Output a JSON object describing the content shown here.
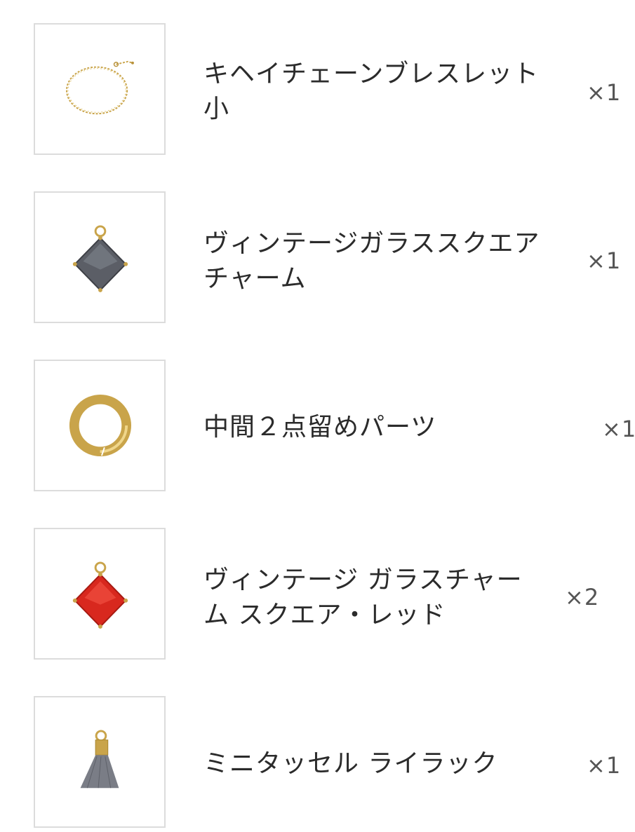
{
  "items": [
    {
      "name": "キヘイチェーンブレスレット小",
      "quantity": "×1",
      "image": "gold-chain-bracelet"
    },
    {
      "name": "ヴィンテージガラススクエアチャーム",
      "quantity": "×1",
      "image": "grey-square-glass-charm"
    },
    {
      "name": "中間２点留めパーツ",
      "quantity": "×1",
      "image": "gold-jump-ring"
    },
    {
      "name": "ヴィンテージ ガラスチャーム スクエア・レッド",
      "quantity": "×2",
      "image": "red-square-glass-charm"
    },
    {
      "name": "ミニタッセル ライラック",
      "quantity": "×1",
      "image": "lilac-mini-tassel"
    }
  ],
  "colors": {
    "border": "#dcdcdc",
    "text": "#2b2b2b",
    "quantity": "#555555",
    "gold": "#c9a44a",
    "grey_stone": "#5b5e66",
    "red_stone": "#d8281e",
    "tassel": "#7a7d86"
  }
}
